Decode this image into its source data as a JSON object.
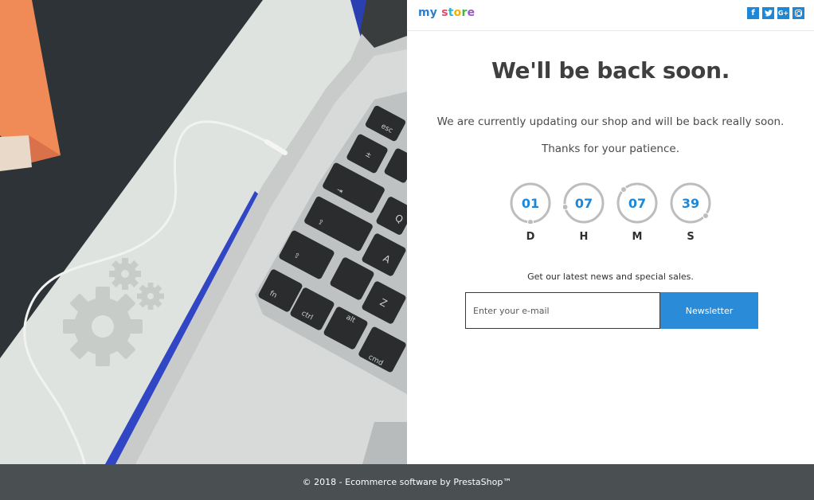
{
  "header": {
    "logo_text": "my store",
    "social": [
      {
        "name": "facebook",
        "glyph": "f"
      },
      {
        "name": "twitter",
        "glyph": "t"
      },
      {
        "name": "google-plus",
        "glyph": "G+"
      },
      {
        "name": "instagram",
        "glyph": ""
      }
    ]
  },
  "main": {
    "title": "We'll be back soon.",
    "message_line1": "We are currently updating our shop and will be back really soon.",
    "message_line2": "Thanks for your patience.",
    "countdown": {
      "days": {
        "value": "01",
        "label": "D"
      },
      "hours": {
        "value": "07",
        "label": "H"
      },
      "minutes": {
        "value": "07",
        "label": "M"
      },
      "seconds": {
        "value": "39",
        "label": "S"
      }
    },
    "newsletter": {
      "label": "Get our latest news and special sales.",
      "placeholder": "Enter your e-mail",
      "button": "Newsletter"
    }
  },
  "footer": {
    "text": "© 2018 - Ecommerce software by PrestaShop™"
  },
  "colors": {
    "accent": "#2a8bd8",
    "footer_bg": "#4a4f52",
    "heading": "#3f3f3f"
  },
  "icons": [
    "gear-icon",
    "facebook-icon",
    "twitter-icon",
    "google-plus-icon",
    "instagram-icon"
  ]
}
